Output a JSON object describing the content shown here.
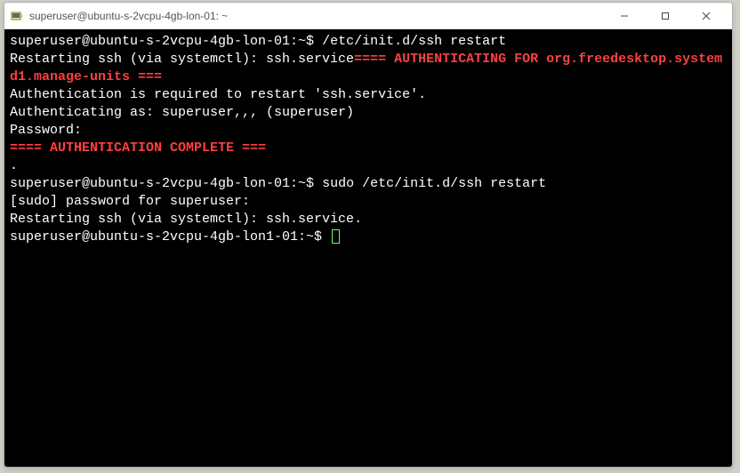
{
  "window": {
    "title": "superuser@ubuntu-s-2vcpu-4gb-lon-01: ~"
  },
  "term": {
    "prompt1": "superuser@ubuntu-s-2vcpu-4gb-lon-01:~$ ",
    "cmd1": "/etc/init.d/ssh restart",
    "line2a": "Restarting ssh (via systemctl): ssh.service",
    "line2b": "==== AUTHENTICATING FOR org.freedesktop.systemd1.manage-units ===",
    "line3": "Authentication is required to restart 'ssh.service'.",
    "line4": "Authenticating as: superuser,,, (superuser)",
    "line5": "Password:",
    "line6": "==== AUTHENTICATION COMPLETE ===",
    "line7": ".",
    "prompt2": "superuser@ubuntu-s-2vcpu-4gb-lon-01:~$ ",
    "cmd2": "sudo /etc/init.d/ssh restart",
    "line9": "[sudo] password for superuser:",
    "line10": "Restarting ssh (via systemctl): ssh.service.",
    "prompt3": "superuser@ubuntu-s-2vcpu-4gb-lon1-01:~$ "
  }
}
